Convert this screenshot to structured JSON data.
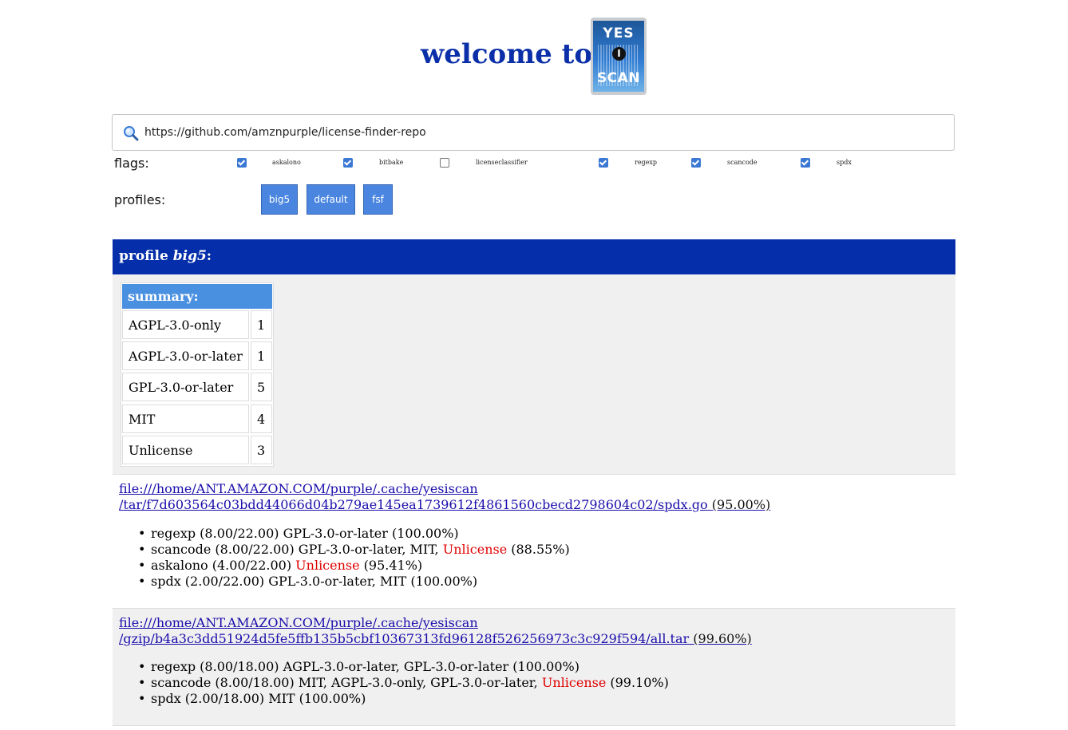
{
  "header": {
    "welcome": "welcome to",
    "logo_top": "YES",
    "logo_mid": "I",
    "logo_bottom": "SCAN"
  },
  "search": {
    "value": "https://github.com/amznpurple/license-finder-repo",
    "icon": "search-icon"
  },
  "flags": {
    "label": "flags:",
    "items": [
      {
        "label": "askalono",
        "checked": true
      },
      {
        "label": "bitbake",
        "checked": true
      },
      {
        "label": "licenseclassifier",
        "checked": false
      },
      {
        "label": "regexp",
        "checked": true
      },
      {
        "label": "scancode",
        "checked": true
      },
      {
        "label": "spdx",
        "checked": true
      }
    ]
  },
  "profiles": {
    "label": "profiles:",
    "buttons": [
      "big5",
      "default",
      "fsf"
    ]
  },
  "profile": {
    "prefix": "profile ",
    "name": "big5",
    "suffix": ":"
  },
  "summary": {
    "title": "summary:",
    "rows": [
      {
        "license": "AGPL-3.0-only",
        "count": "1"
      },
      {
        "license": "AGPL-3.0-or-later",
        "count": "1"
      },
      {
        "license": "GPL-3.0-or-later",
        "count": "5"
      },
      {
        "license": "MIT",
        "count": "4"
      },
      {
        "license": "Unlicense",
        "count": "3"
      }
    ]
  },
  "files": [
    {
      "link_line1": "file:///home/ANT.AMAZON.COM/purple/.cache/yesiscan",
      "link_line2": "/tar/f7d603564c03bdd44066d04b279ae145ea1739612f4861560cbecd2798604c02/spdx.go",
      "percent": "(95.00%)",
      "results": [
        {
          "before": "regexp (8.00/22.00) GPL-3.0-or-later (100.00%)",
          "red": "",
          "after": ""
        },
        {
          "before": "scancode (8.00/22.00) GPL-3.0-or-later, MIT, ",
          "red": "Unlicense",
          "after": " (88.55%)"
        },
        {
          "before": "askalono (4.00/22.00) ",
          "red": "Unlicense",
          "after": " (95.41%)"
        },
        {
          "before": "spdx (2.00/22.00) GPL-3.0-or-later, MIT (100.00%)",
          "red": "",
          "after": ""
        }
      ]
    },
    {
      "link_line1": "file:///home/ANT.AMAZON.COM/purple/.cache/yesiscan",
      "link_line2": "/gzip/b4a3c3dd51924d5fe5ffb135b5cbf10367313fd96128f526256973c3c929f594/all.tar",
      "percent": "(99.60%)",
      "results": [
        {
          "before": "regexp (8.00/18.00) AGPL-3.0-or-later, GPL-3.0-or-later (100.00%)",
          "red": "",
          "after": ""
        },
        {
          "before": "scancode (8.00/18.00) MIT, AGPL-3.0-only, GPL-3.0-or-later, ",
          "red": "Unlicense",
          "after": " (99.10%)"
        },
        {
          "before": "spdx (2.00/18.00) MIT (100.00%)",
          "red": "",
          "after": ""
        }
      ]
    }
  ],
  "colors": {
    "brand_blue": "#052faa",
    "button_blue": "#4a86e0",
    "summary_head": "#4a90e0",
    "link": "#1a0dab",
    "unlicense_red": "#e00000"
  }
}
